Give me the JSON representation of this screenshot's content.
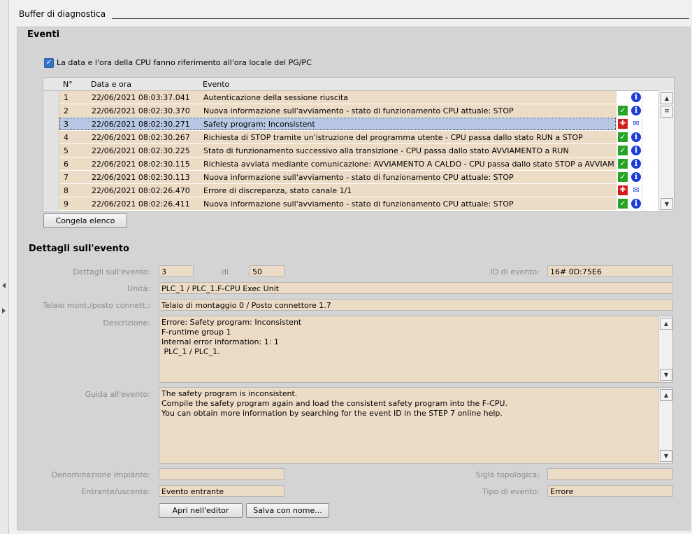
{
  "panel": {
    "title": "Buffer di diagnostica"
  },
  "events": {
    "title": "Eventi",
    "checkbox_label": "La data e l'ora della CPU fanno riferimento all'ora locale del PG/PC",
    "checkbox_checked": true,
    "columns": [
      "N°",
      "Data e ora",
      "Evento"
    ],
    "rows": [
      {
        "no": "1",
        "datetime": "22/06/2021 08:03:37.041",
        "event": "Autenticazione della sessione riuscita",
        "icons": [
          "info-icon"
        ]
      },
      {
        "no": "2",
        "datetime": "22/06/2021 08:02:30.370",
        "event": "Nuova informazione sull'avviamento  - stato di funzionamento CPU attuale: STOP",
        "icons": [
          "ok-icon",
          "info-icon"
        ]
      },
      {
        "no": "3",
        "datetime": "22/06/2021 08:02:30.271",
        "event": "Safety program: Inconsistent",
        "icons": [
          "error-icon",
          "message-icon"
        ],
        "selected": true
      },
      {
        "no": "4",
        "datetime": "22/06/2021 08:02:30.267",
        "event": "Richiesta di STOP tramite un'istruzione del programma utente - CPU passa dallo stato RUN a STOP",
        "icons": [
          "ok-icon",
          "info-icon"
        ]
      },
      {
        "no": "5",
        "datetime": "22/06/2021 08:02:30.225",
        "event": "Stato di funzionamento successivo alla transizione  - CPU passa dallo stato AVVIAMENTO a RUN",
        "icons": [
          "ok-icon",
          "info-icon"
        ]
      },
      {
        "no": "6",
        "datetime": "22/06/2021 08:02:30.115",
        "event": "Richiesta avviata mediante comunicazione: AVVIAMENTO A CALDO  - CPU passa dallo stato STOP a AVVIAME...",
        "icons": [
          "ok-icon",
          "info-icon"
        ]
      },
      {
        "no": "7",
        "datetime": "22/06/2021 08:02:30.113",
        "event": "Nuova informazione sull'avviamento  - stato di funzionamento CPU attuale: STOP",
        "icons": [
          "ok-icon",
          "info-icon"
        ]
      },
      {
        "no": "8",
        "datetime": "22/06/2021 08:02:26.470",
        "event": "Errore di discrepanza, stato canale 1/1",
        "icons": [
          "error-icon",
          "message-icon"
        ]
      },
      {
        "no": "9",
        "datetime": "22/06/2021 08:02:26.411",
        "event": "Nuova informazione sull'avviamento  - stato di funzionamento CPU attuale: STOP",
        "icons": [
          "ok-icon",
          "info-icon"
        ]
      }
    ],
    "freeze_button": "Congela elenco"
  },
  "details": {
    "title": "Dettagli sull'evento",
    "detail_label": "Dettagli sull'evento:",
    "detail_value": "3",
    "of_label": "di",
    "of_value": "50",
    "event_id_label": "ID di evento:",
    "event_id_value": "16# 0D:75E6",
    "unit_label": "Unità:",
    "unit_value": "PLC_1 / PLC_1.F-CPU Exec Unit",
    "rack_label": "Telaio mont./posto connett.:",
    "rack_value": "Telaio di montaggio 0 / Posto connettore 1.7",
    "description_label": "Descrizione:",
    "description_lines": [
      "Errore: Safety program: Inconsistent",
      "F-runtime group   1",
      "Internal error information:   1:  1",
      " PLC_1 / PLC_1."
    ],
    "help_label": "Guida all'evento:",
    "help_lines": [
      "The safety program is inconsistent.",
      "Compile the safety program again and load the consistent safety program into the F-CPU.",
      "You can obtain more information by searching for the event ID in the STEP 7 online help."
    ],
    "plant_label": "Denominazione impianto:",
    "plant_value": "",
    "topo_label": "Sigla topologica:",
    "topo_value": "",
    "inout_label": "Entrante/uscente:",
    "inout_value": "Evento entrante",
    "type_label": "Tipo di evento:",
    "type_value": "Errore",
    "open_editor_button": "Apri nell'editor",
    "save_as_button": "Salva con nome..."
  },
  "colors": {
    "field_bg": "#ecdcc6",
    "selected_row": "#b8c8e4",
    "panel_bg": "#d4d4d4"
  }
}
